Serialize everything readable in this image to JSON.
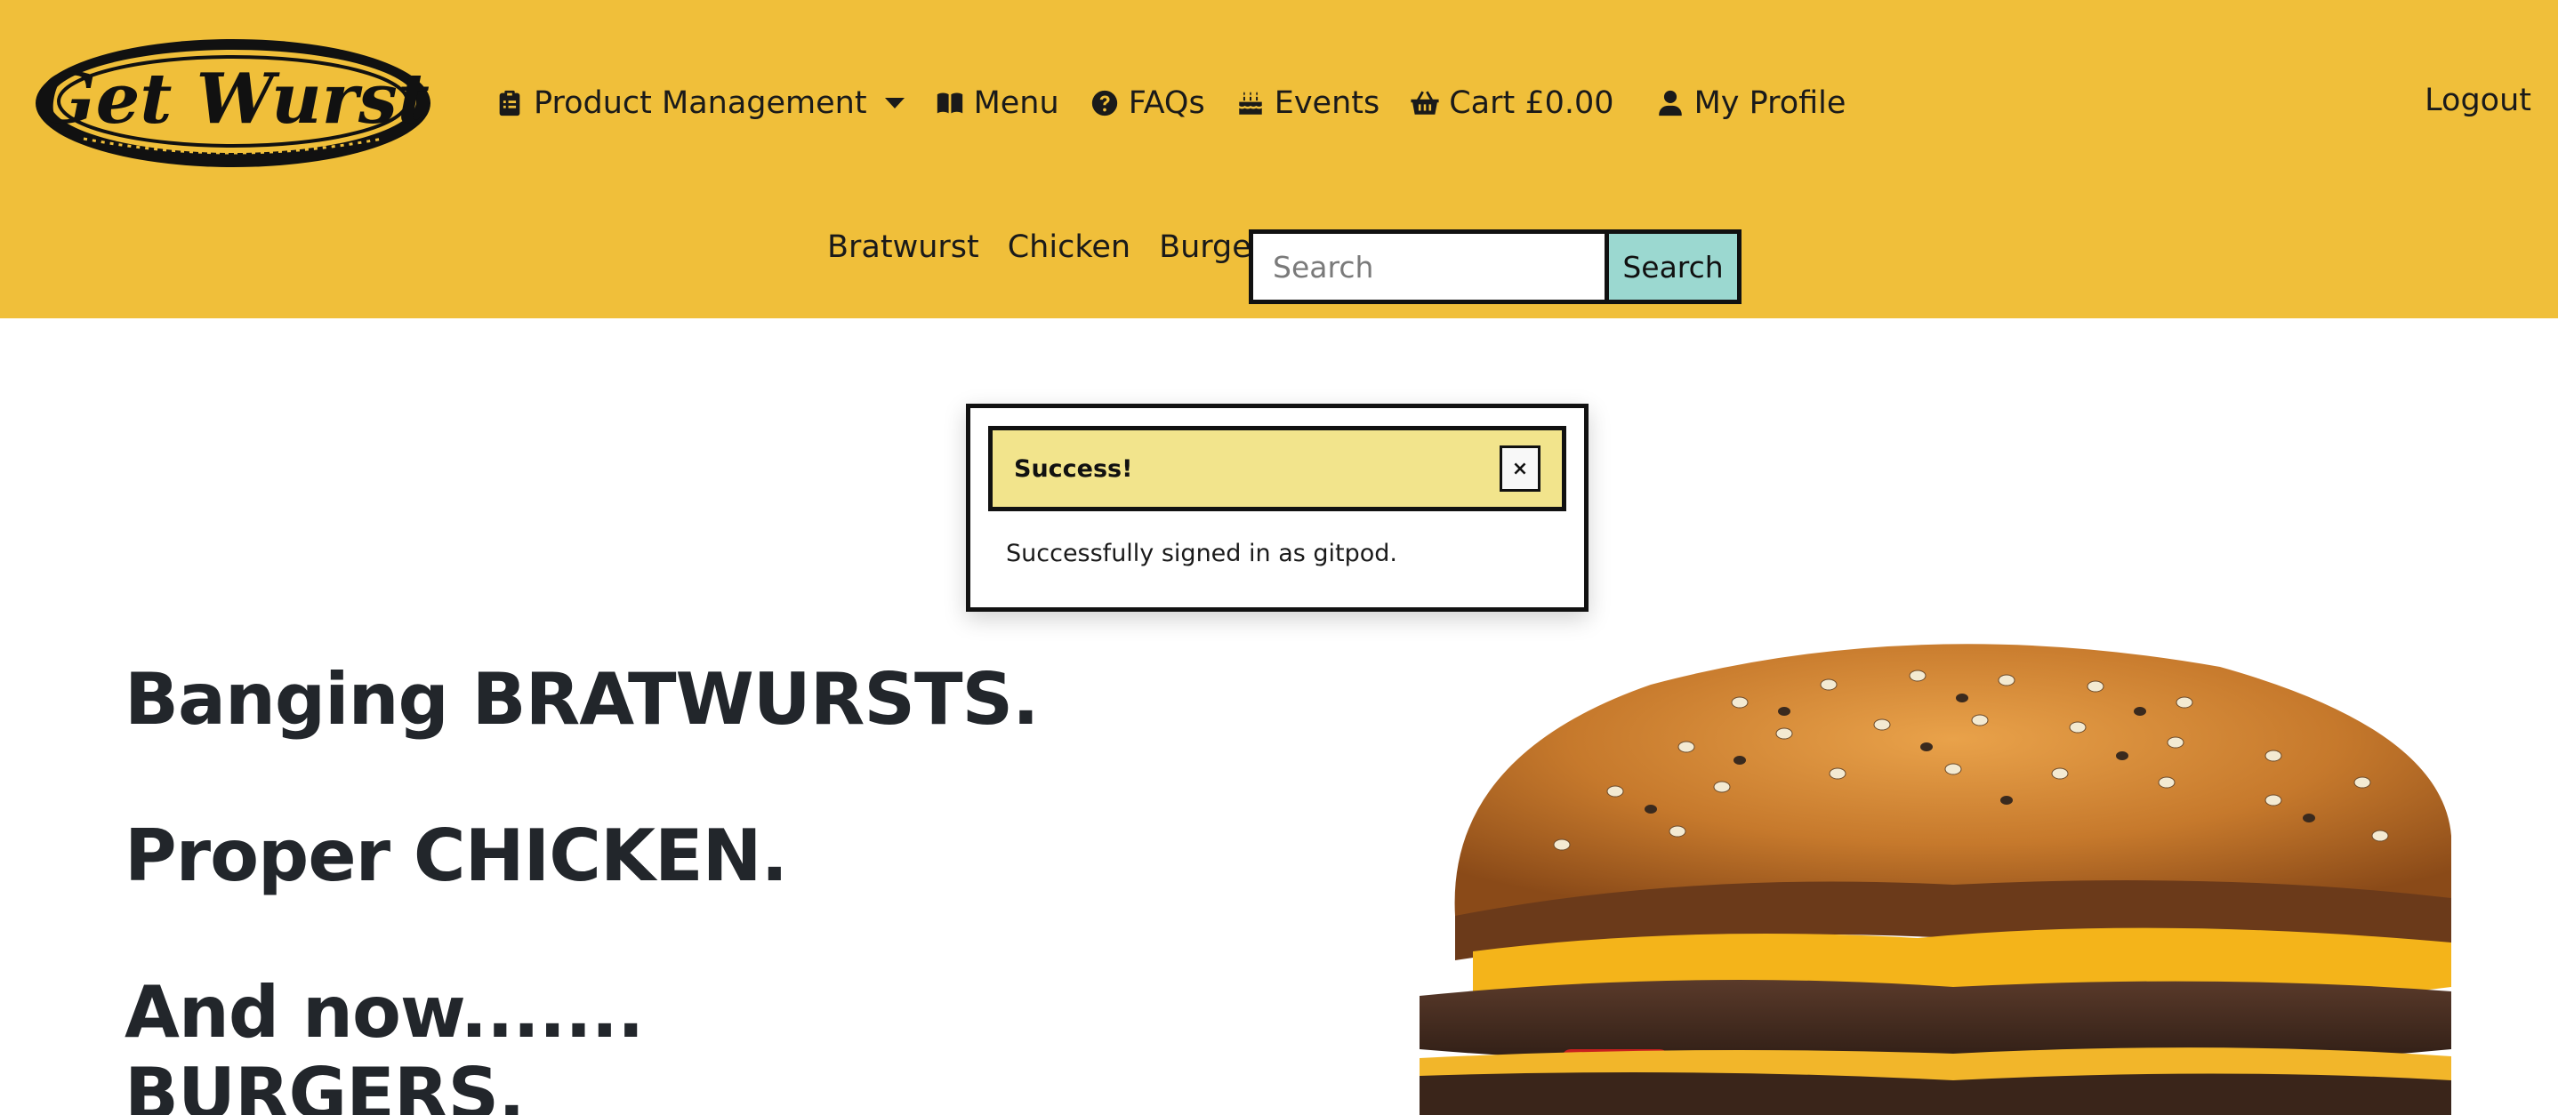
{
  "header": {
    "logo_text": "Get Wurst",
    "nav": {
      "product_management": "Product Management",
      "menu": "Menu",
      "faqs": "FAQs",
      "events": "Events",
      "cart": "Cart £0.00",
      "my_profile": "My Profile",
      "logout": "Logout"
    },
    "categories": [
      "Bratwurst",
      "Chicken",
      "Burgers"
    ],
    "search": {
      "placeholder": "Search",
      "button": "Search"
    }
  },
  "toast": {
    "title": "Success!",
    "close": "×",
    "message": "Successfully signed in as gitpod."
  },
  "hero": {
    "line1": "Banging BRATWURSTS.",
    "line2": "Proper CHICKEN.",
    "line3": "And now.......",
    "line4": "BURGERS."
  },
  "colors": {
    "header_bg": "#f0bf3a",
    "search_button": "#9bd8d0",
    "toast_header": "#f2e48c",
    "hero_text": "#22262b"
  },
  "icons": {
    "product_management": "clipboard-list-icon",
    "menu": "book-open-icon",
    "faqs": "question-circle-icon",
    "events": "birthday-cake-icon",
    "cart": "shopping-basket-icon",
    "my_profile": "user-icon"
  }
}
